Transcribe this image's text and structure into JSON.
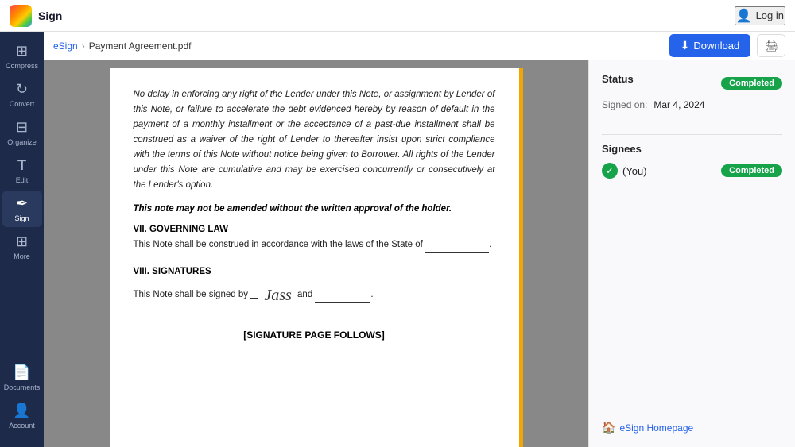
{
  "topbar": {
    "app_name": "Sign",
    "login_label": "Log in"
  },
  "breadcrumb": {
    "esign": "eSign",
    "separator": "›",
    "file_name": "Payment Agreement.pdf"
  },
  "toolbar": {
    "download_label": "Download",
    "download_icon": "⬇"
  },
  "sidebar": {
    "items": [
      {
        "id": "compress",
        "label": "Compress",
        "icon": "⊞"
      },
      {
        "id": "convert",
        "label": "Convert",
        "icon": "↻"
      },
      {
        "id": "organize",
        "label": "Organize",
        "icon": "⊟"
      },
      {
        "id": "edit",
        "label": "Edit",
        "icon": "T"
      },
      {
        "id": "sign",
        "label": "Sign",
        "icon": "✒",
        "active": true
      },
      {
        "id": "more",
        "label": "More",
        "icon": "⊞"
      }
    ],
    "bottom": [
      {
        "id": "documents",
        "label": "Documents",
        "icon": "📄"
      },
      {
        "id": "account",
        "label": "Account",
        "icon": "👤"
      }
    ]
  },
  "pdf": {
    "paragraph1": "No delay in enforcing any right of the Lender under this Note, or assignment by Lender of this Note, or failure to accelerate the debt evidenced hereby by reason of default in the payment of a monthly installment or the acceptance of a past-due installment shall be construed as a waiver of the right of Lender to thereafter insist upon strict compliance with the terms of this Note without notice being given to Borrower. All rights of the Lender under this Note are cumulative and may be exercised concurrently or consecutively at the Lender's option.",
    "bold_note": "This note may not be amended without the written approval of the holder.",
    "section7_title": "VII. GOVERNING LAW",
    "section7_text": "This Note shall be construed in accordance with the laws of the State of",
    "section8_title": "VIII. SIGNATURES",
    "section8_text_before": "This Note shall be signed by",
    "signature_text": "Jass",
    "section8_text_after": "and",
    "sig_page_follows": "[SIGNATURE PAGE FOLLOWS]"
  },
  "panel": {
    "status_title": "Status",
    "status_badge": "Completed",
    "signed_on_label": "Signed on:",
    "signed_on_date": "Mar 4, 2024",
    "signees_title": "Signees",
    "signee_name": "(You)",
    "signee_badge": "Completed",
    "esign_link": "eSign Homepage"
  }
}
